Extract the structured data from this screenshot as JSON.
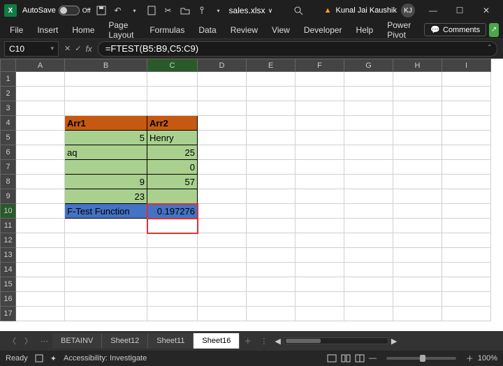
{
  "titlebar": {
    "autosave_label": "AutoSave",
    "autosave_state": "Off",
    "filename": "sales.xlsx",
    "search_icon": "search",
    "user_name": "Kunal Jai Kaushik",
    "user_initials": "KJ"
  },
  "ribbon": {
    "tabs": [
      "File",
      "Insert",
      "Home",
      "Page Layout",
      "Formulas",
      "Data",
      "Review",
      "View",
      "Developer",
      "Help",
      "Power Pivot"
    ],
    "comments_label": "Comments"
  },
  "formula_bar": {
    "name_box": "C10",
    "formula": "=FTEST(B5:B9,C5:C9)"
  },
  "columns": [
    "A",
    "B",
    "C",
    "D",
    "E",
    "F",
    "G",
    "H",
    "I"
  ],
  "rows": [
    "1",
    "2",
    "3",
    "4",
    "5",
    "6",
    "7",
    "8",
    "9",
    "10",
    "11",
    "12",
    "13",
    "14",
    "15",
    "16",
    "17"
  ],
  "cells": {
    "B4": "Arr1",
    "C4": "Arr2",
    "B5": "5",
    "C5": "Henry",
    "B6": "aq",
    "C6": "25",
    "B7": "",
    "C7": "0",
    "B8": "9",
    "C8": "57",
    "B9": "23",
    "C9": "",
    "B10": "F-Test Function",
    "C10": "0.197276"
  },
  "sheet_tabs": {
    "tabs": [
      "BETAINV",
      "Sheet12",
      "Sheet11",
      "Sheet16"
    ],
    "active": "Sheet16"
  },
  "status": {
    "ready": "Ready",
    "accessibility": "Accessibility: Investigate",
    "zoom": "100%"
  },
  "chart_data": {
    "type": "table",
    "title": "F-Test data",
    "columns": [
      "Arr1",
      "Arr2"
    ],
    "rows": [
      [
        "5",
        "Henry"
      ],
      [
        "aq",
        "25"
      ],
      [
        "",
        "0"
      ],
      [
        "9",
        "57"
      ],
      [
        "23",
        ""
      ]
    ],
    "result_label": "F-Test Function",
    "result_value": 0.197276,
    "formula": "=FTEST(B5:B9,C5:C9)"
  }
}
